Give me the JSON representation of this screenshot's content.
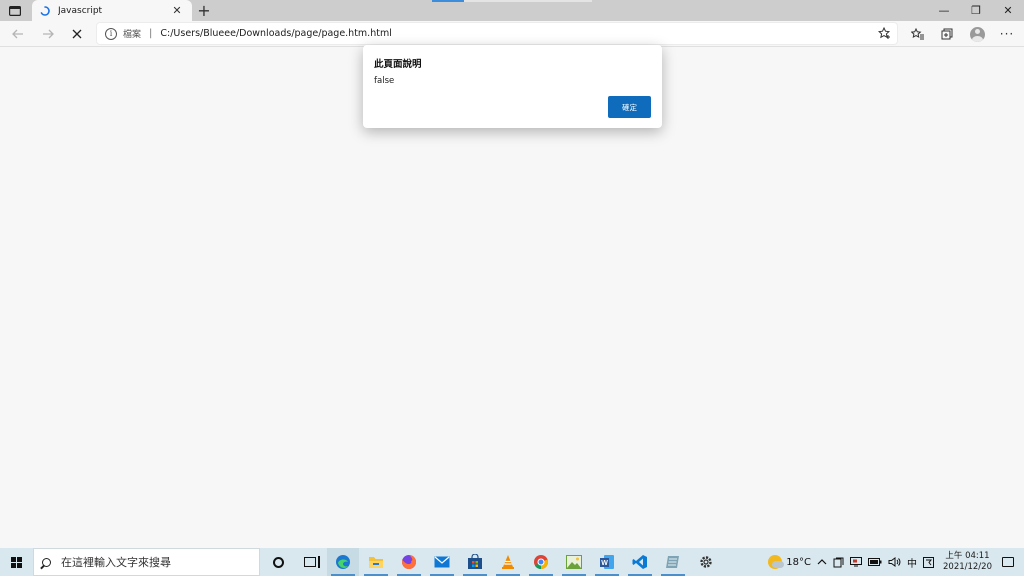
{
  "browser": {
    "tab": {
      "title": "Javascript",
      "close_glyph": "✕"
    },
    "new_tab_glyph": "+",
    "address": {
      "scheme_label": "檔案",
      "separator": "|",
      "url": "C:/Users/Blueee/Downloads/page/page.htm.html"
    },
    "window_controls": {
      "minimize": "—",
      "restore": "❐",
      "close": "✕"
    }
  },
  "dialog": {
    "title": "此頁面說明",
    "message": "false",
    "ok_label": "確定"
  },
  "taskbar": {
    "search_placeholder": "在這裡輸入文字來搜尋",
    "weather": "18°C",
    "ime": "中",
    "time": "上午 04:11",
    "date": "2021/12/20",
    "colors": {
      "edge": "#1b78d0",
      "explorer": "#f3c13a",
      "firefox": "#ff7139",
      "mail": "#0f78d4",
      "store": "#1e4f8a",
      "vlc": "#f08a00",
      "chrome": "#db4437",
      "photos": "#6ba33a",
      "word": "#2b579a",
      "vscode": "#0a7ad4",
      "notes": "#7da3b5",
      "settings": "#333333"
    }
  }
}
